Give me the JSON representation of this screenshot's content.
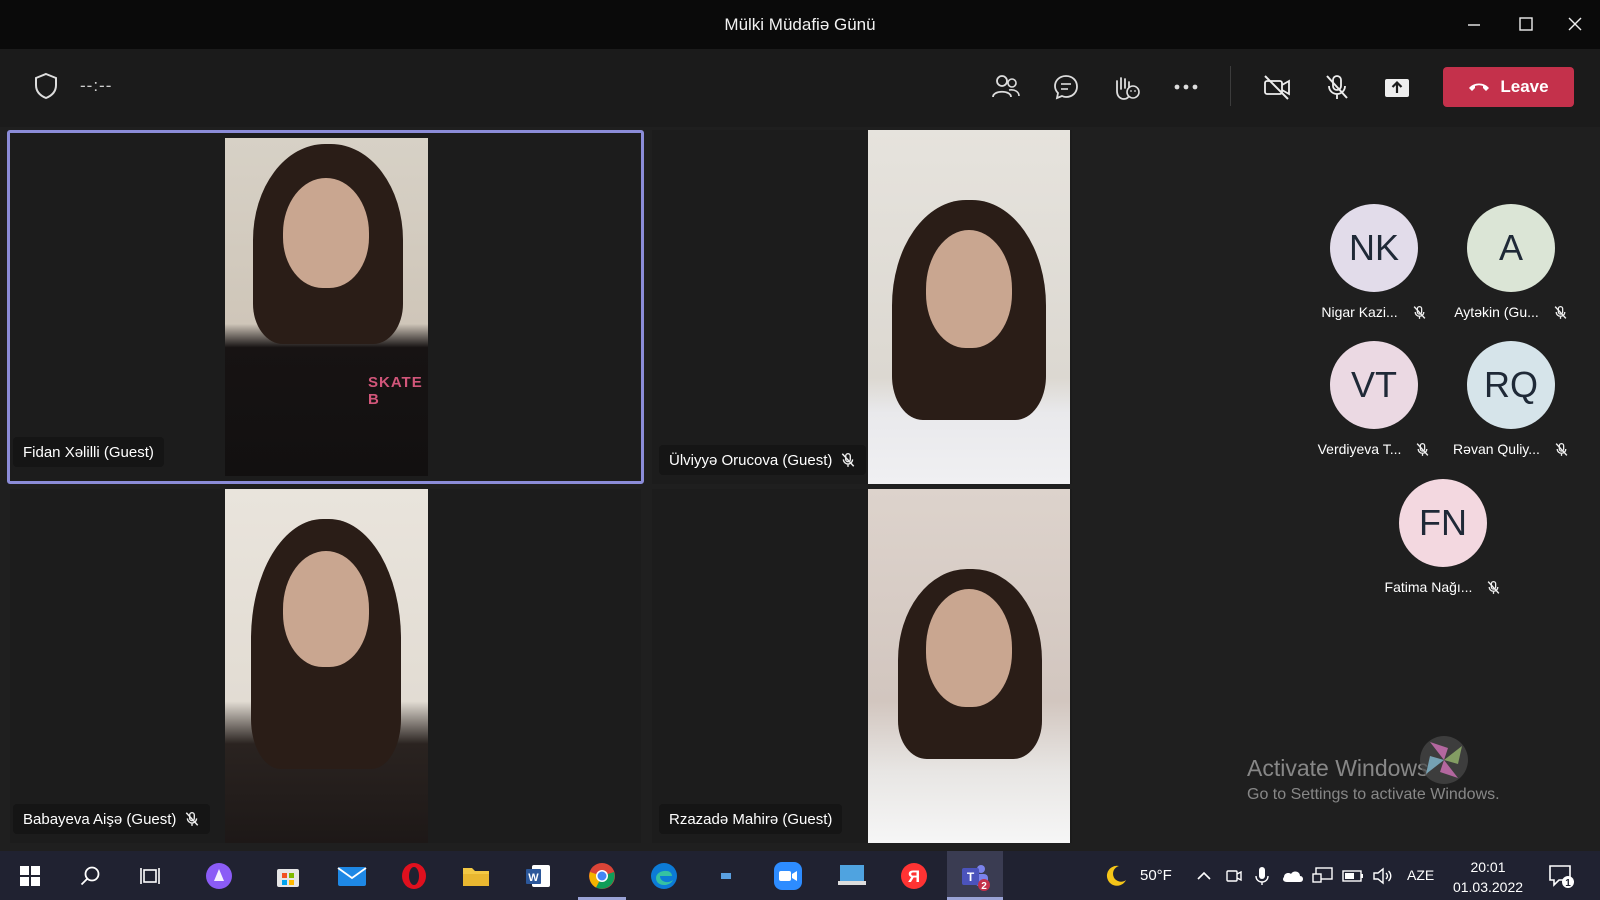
{
  "window": {
    "title": "Mülki Müdafiə Günü"
  },
  "toolbar": {
    "timer": "--:--",
    "leave_label": "Leave",
    "leave_color": "#c4314b"
  },
  "tiles": [
    {
      "name": "Fidan Xəlilli (Guest)",
      "muted": false,
      "active_speaker": true,
      "shirt_text": "SKATE B"
    },
    {
      "name": "Ülviyyə Orucova (Guest)",
      "muted": true
    },
    {
      "name": "Babayeva Aişə (Guest)",
      "muted": true
    },
    {
      "name": "Rzazadə Mahirə (Guest)",
      "muted": false
    }
  ],
  "participants": [
    {
      "initials": "NK",
      "name": "Nigar Kazi...",
      "muted": true,
      "color": "#e2dcea"
    },
    {
      "initials": "A",
      "name": "Aytəkin (Gu...",
      "muted": true,
      "color": "#dbe5d6"
    },
    {
      "initials": "VT",
      "name": "Verdiyeva T...",
      "muted": true,
      "color": "#ebd9e3"
    },
    {
      "initials": "RQ",
      "name": "Rəvan Quliy...",
      "muted": true,
      "color": "#d6e4ea"
    },
    {
      "initials": "FN",
      "name": "Fatima Nağı...",
      "muted": true,
      "color": "#f3d8e0"
    }
  ],
  "watermark": {
    "line1": "Activate Windows",
    "line2": "Go to Settings to activate Windows."
  },
  "taskbar": {
    "weather": "50°F",
    "language": "AZE",
    "time": "20:01",
    "date": "01.03.2022",
    "teams_badge": "2",
    "notification_count": "1"
  }
}
